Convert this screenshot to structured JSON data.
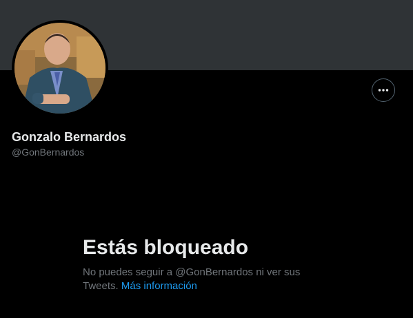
{
  "profile": {
    "display_name": "Gonzalo Bernardos",
    "handle": "@GonBernardos"
  },
  "actions": {
    "more_icon": "more-horizontal-icon"
  },
  "blocked": {
    "title": "Estás bloqueado",
    "message": "No puedes seguir a @GonBernardos ni ver sus Tweets.",
    "link_label": "Más información"
  },
  "colors": {
    "background": "#000000",
    "banner": "#2f3336",
    "primary_text": "#e7e9ea",
    "secondary_text": "#71767b",
    "link": "#1d9bf0"
  }
}
